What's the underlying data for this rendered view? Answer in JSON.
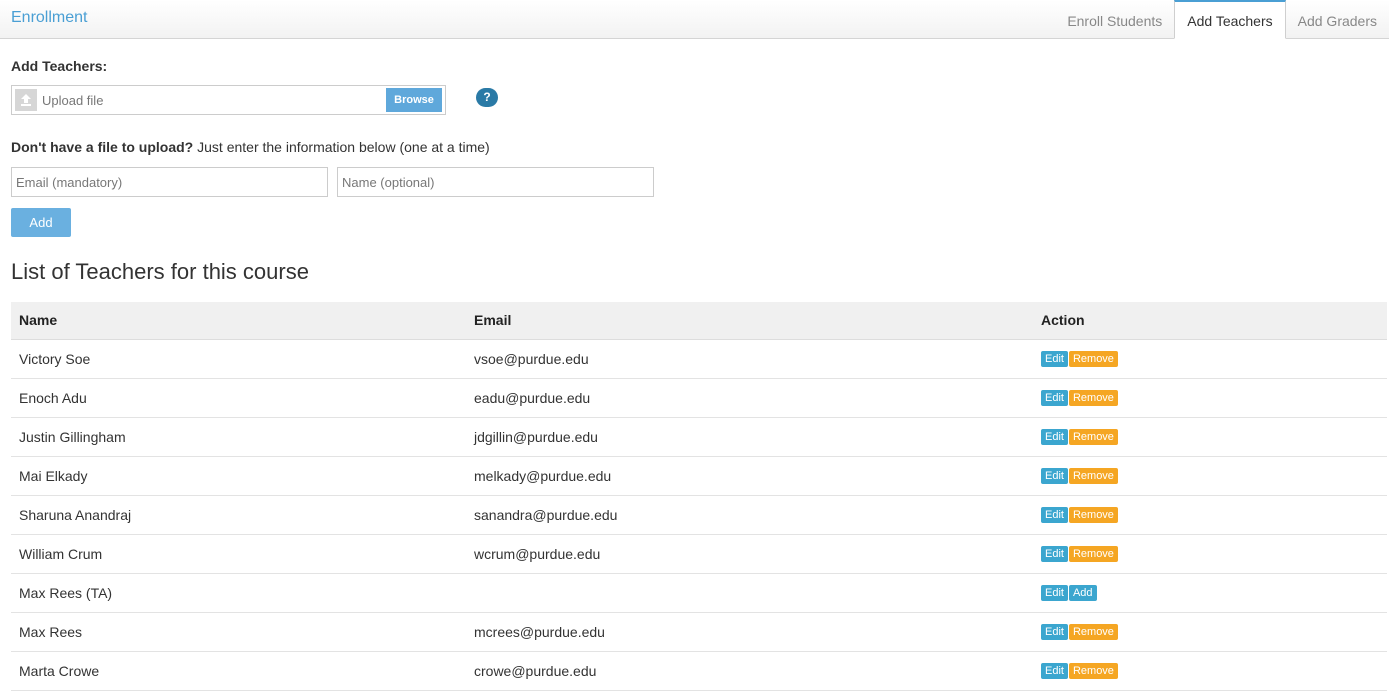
{
  "header": {
    "title": "Enrollment",
    "tabs": [
      {
        "label": "Enroll Students",
        "active": false
      },
      {
        "label": "Add Teachers",
        "active": true
      },
      {
        "label": "Add Graders",
        "active": false
      }
    ]
  },
  "upload": {
    "section_label": "Add Teachers:",
    "placeholder": "Upload file",
    "browse_label": "Browse",
    "help_label": "?"
  },
  "manual": {
    "prompt_bold": "Don't have a file to upload?",
    "prompt_rest": " Just enter the information below (one at a time)",
    "email_placeholder": "Email (mandatory)",
    "name_placeholder": "Name (optional)",
    "add_label": "Add"
  },
  "list": {
    "title": "List of Teachers for this course",
    "columns": [
      "Name",
      "Email",
      "Action"
    ],
    "rows": [
      {
        "name": "Victory Soe",
        "email": "vsoe@purdue.edu",
        "actions": [
          "Edit",
          "Remove"
        ]
      },
      {
        "name": "Enoch Adu",
        "email": "eadu@purdue.edu",
        "actions": [
          "Edit",
          "Remove"
        ]
      },
      {
        "name": "Justin Gillingham",
        "email": "jdgillin@purdue.edu",
        "actions": [
          "Edit",
          "Remove"
        ]
      },
      {
        "name": "Mai Elkady",
        "email": "melkady@purdue.edu",
        "actions": [
          "Edit",
          "Remove"
        ]
      },
      {
        "name": "Sharuna Anandraj",
        "email": "sanandra@purdue.edu",
        "actions": [
          "Edit",
          "Remove"
        ]
      },
      {
        "name": "William Crum",
        "email": "wcrum@purdue.edu",
        "actions": [
          "Edit",
          "Remove"
        ]
      },
      {
        "name": "Max Rees (TA)",
        "email": "",
        "actions": [
          "Edit",
          "Add"
        ]
      },
      {
        "name": "Max Rees",
        "email": "mcrees@purdue.edu",
        "actions": [
          "Edit",
          "Remove"
        ]
      },
      {
        "name": "Marta Crowe",
        "email": "crowe@purdue.edu",
        "actions": [
          "Edit",
          "Remove"
        ]
      }
    ]
  },
  "colors": {
    "accent": "#4a9fd4",
    "edit_button": "#3ba6cf",
    "remove_button": "#f5a623",
    "help_icon": "#2a7aa6"
  },
  "icons": {
    "upload": "upload-arrow-icon",
    "help": "question-mark-icon"
  }
}
